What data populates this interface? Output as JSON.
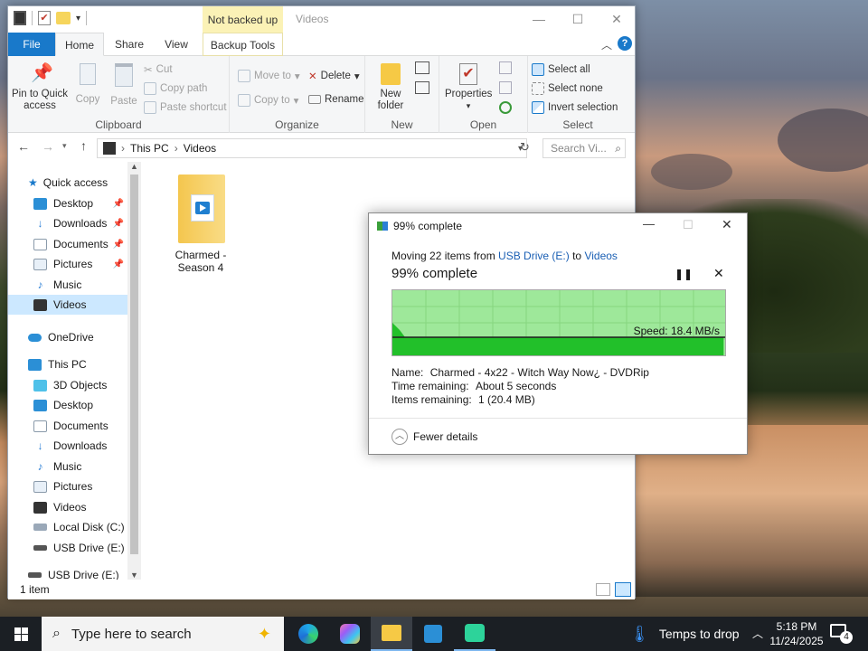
{
  "explorer": {
    "title": "Videos",
    "context_tab": "Not backed up",
    "tabs": [
      "File",
      "Home",
      "Share",
      "View",
      "Backup Tools"
    ],
    "ribbon": {
      "clipboard": {
        "label": "Clipboard",
        "pin": "Pin to Quick access",
        "copy": "Copy",
        "paste": "Paste",
        "cut": "Cut",
        "copy_path": "Copy path",
        "paste_shortcut": "Paste shortcut"
      },
      "organize": {
        "label": "Organize",
        "move_to": "Move to",
        "copy_to": "Copy to",
        "delete": "Delete",
        "rename": "Rename"
      },
      "new": {
        "label": "New",
        "new_folder": "New folder"
      },
      "open": {
        "label": "Open",
        "properties": "Properties"
      },
      "select": {
        "label": "Select",
        "select_all": "Select all",
        "select_none": "Select none",
        "invert": "Invert selection"
      }
    },
    "address": {
      "crumbs": [
        "This PC",
        "Videos"
      ],
      "search_placeholder": "Search Vi..."
    },
    "nav": {
      "quick_access": "Quick access",
      "quick_items": [
        "Desktop",
        "Downloads",
        "Documents",
        "Pictures",
        "Music",
        "Videos"
      ],
      "onedrive": "OneDrive",
      "this_pc": "This PC",
      "pc_items": [
        "3D Objects",
        "Desktop",
        "Documents",
        "Downloads",
        "Music",
        "Pictures",
        "Videos",
        "Local Disk (C:)",
        "USB Drive (E:)"
      ],
      "usb": "USB Drive (E:)"
    },
    "folder": {
      "name": "Charmed - Season 4"
    },
    "status": "1 item"
  },
  "dialog": {
    "title": "99% complete",
    "moving_prefix": "Moving 22 items from",
    "source": "USB Drive (E:)",
    "to": "to",
    "dest": "Videos",
    "headline": "99% complete",
    "speed": "Speed: 18.4 MB/s",
    "progress": 0.99,
    "name_label": "Name:",
    "name_value": "Charmed - 4x22 - Witch Way Now¿ - DVDRip",
    "time_label": "Time remaining:",
    "time_value": "About 5 seconds",
    "items_label": "Items remaining:",
    "items_value": "1 (20.4 MB)",
    "fewer_details": "Fewer details"
  },
  "taskbar": {
    "search_placeholder": "Type here to search",
    "weather": "Temps to drop",
    "time": "5:18 PM",
    "date": "11/24/2025",
    "notifications": "4"
  },
  "colors": {
    "accent": "#1979ca",
    "progress_fill": "#22c02a",
    "progress_bg": "#9ee89a",
    "selection": "#cce8ff"
  }
}
